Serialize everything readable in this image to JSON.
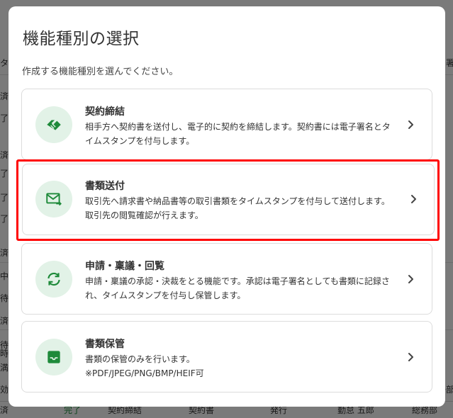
{
  "background": {
    "left_fragments": [
      "タ",
      "済",
      "了済",
      "済",
      "了済",
      "了済",
      "了済",
      "済",
      "中",
      "待",
      "済",
      "待",
      "時",
      "満",
      "効",
      "済"
    ],
    "right_fragments": [
      "署"
    ],
    "bottom_row": {
      "status": "完了",
      "type": "契約締結",
      "doc": "契約書",
      "action": "発行",
      "person": "勤怠 五郎",
      "dept": "総務部",
      "right_partial": "務部",
      "left_partial": "済"
    }
  },
  "modal": {
    "title": "機能種別の選択",
    "description": "作成する機能種別を選んでください。",
    "options": [
      {
        "title": "契約締結",
        "text": "相手方へ契約書を送付し、電子的に契約を締結します。契約書には電子署名とタイムスタンプを付与します。",
        "icon": "handshake-icon"
      },
      {
        "title": "書類送付",
        "text": "取引先へ請求書や納品書等の取引書類をタイムスタンプを付与して送付します。取引先の閲覧確認が行えます。",
        "icon": "mail-send-icon"
      },
      {
        "title": "申請・稟議・回覧",
        "text": "申請・稟議の承認・決裁をとる機能です。承認は電子署名としても書類に記録され、タイムスタンプを付与し保管します。",
        "icon": "sync-icon"
      },
      {
        "title": "書類保管",
        "text": "書類の保管のみを行います。",
        "text2": "※PDF/JPEG/PNG/BMP/HEIF可",
        "icon": "inbox-icon"
      }
    ]
  },
  "colors": {
    "accent": "#1e8a3a",
    "icon_bg": "#e2f2e7",
    "highlight": "#ff0000"
  }
}
